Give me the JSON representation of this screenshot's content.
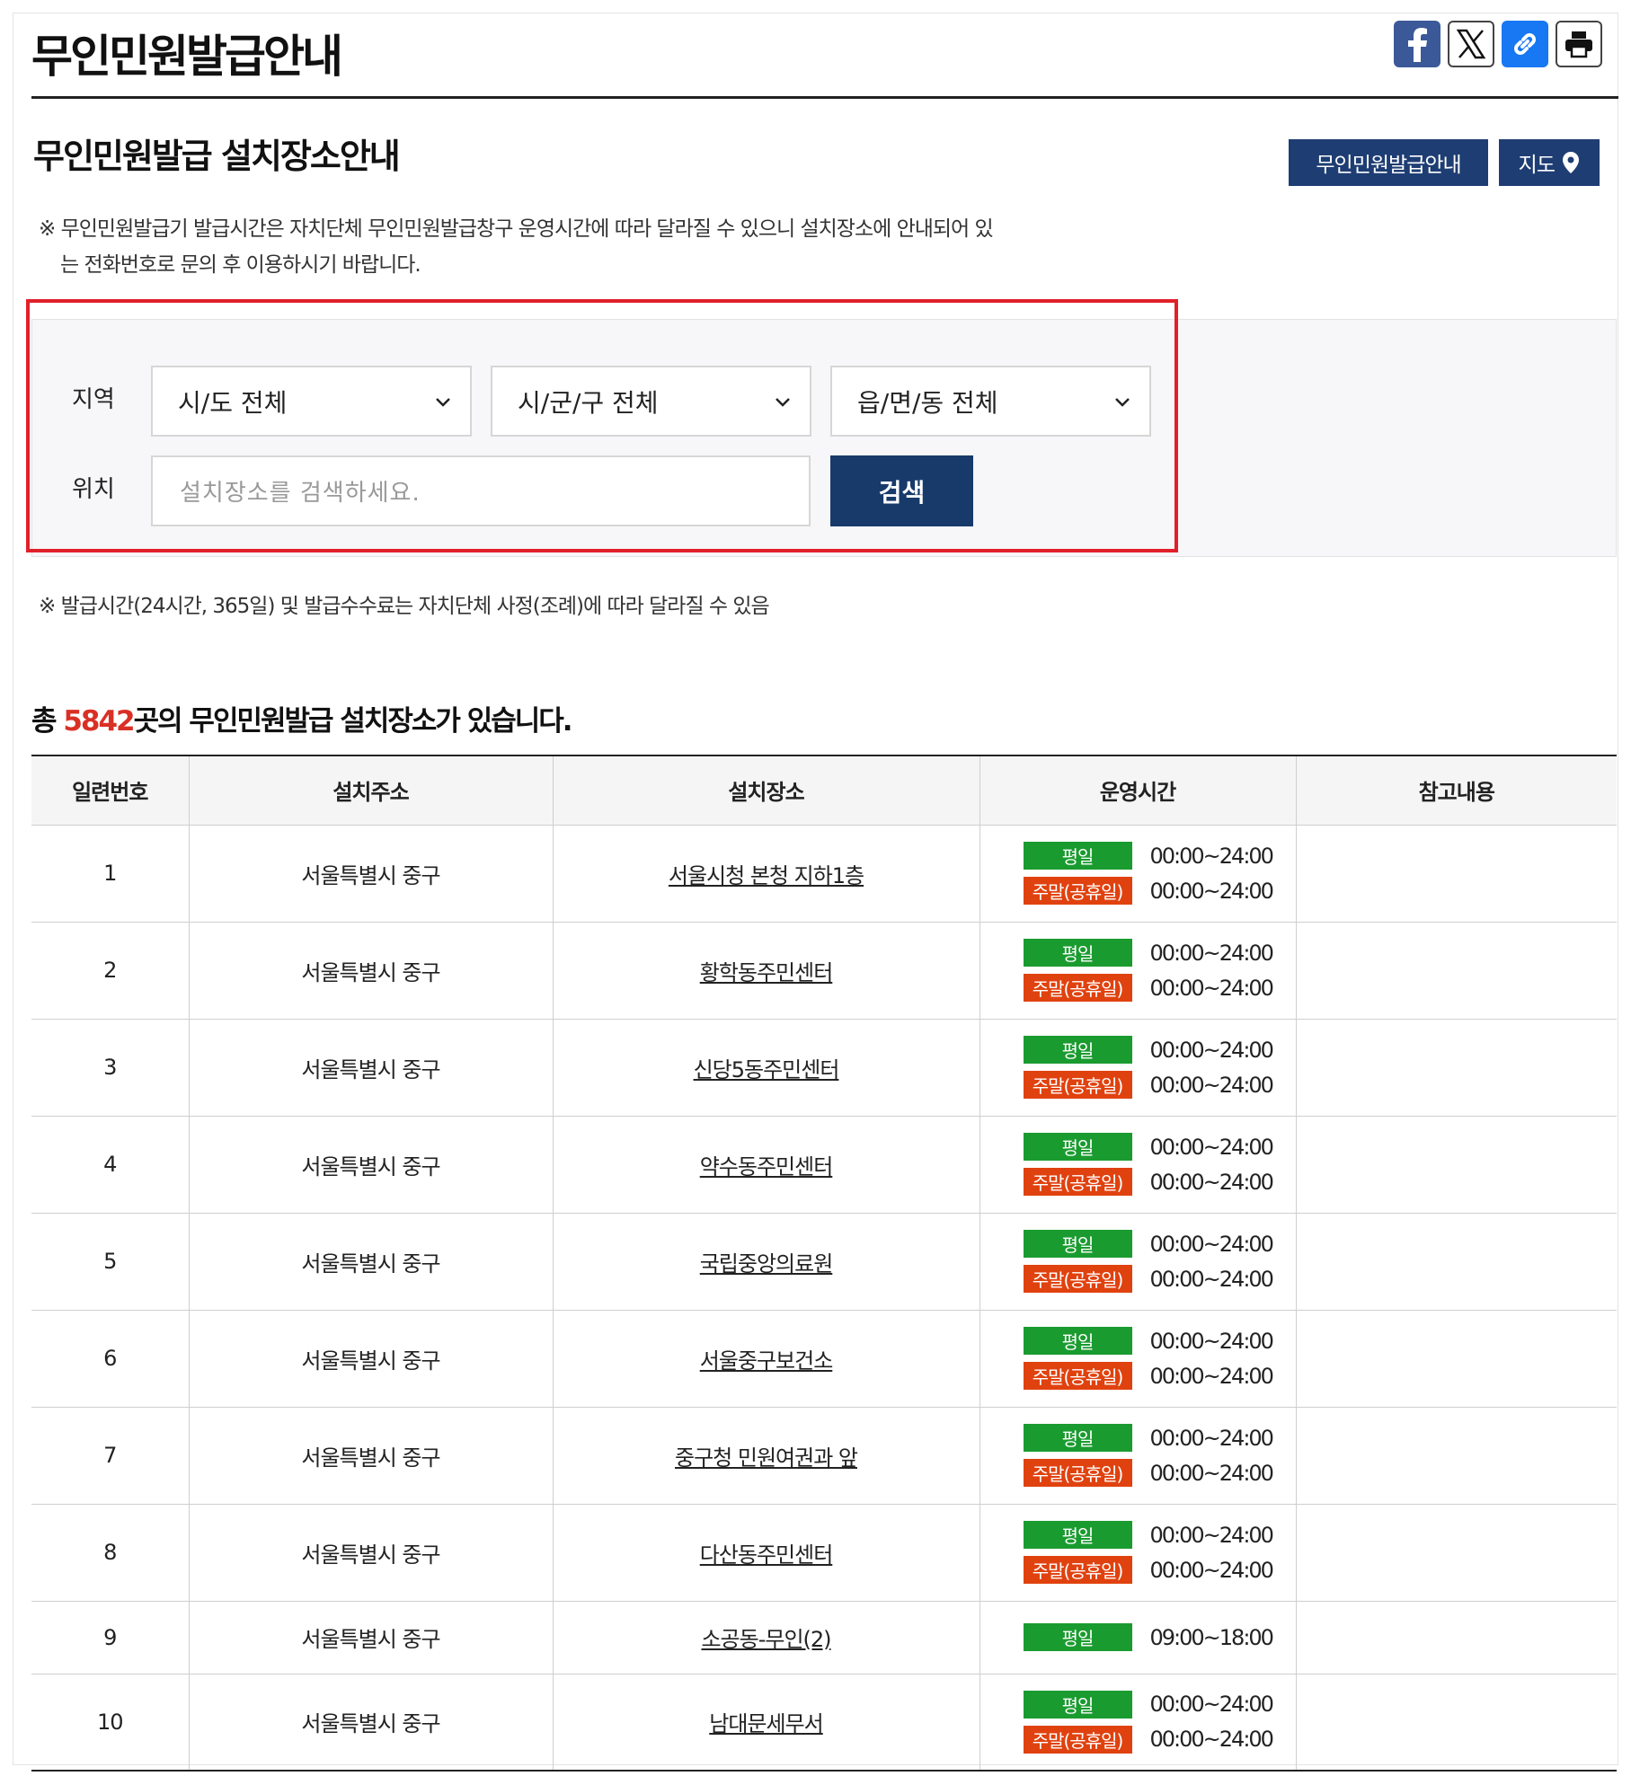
{
  "header": {
    "title": "무인민원발급안내",
    "share": [
      {
        "name": "facebook-icon"
      },
      {
        "name": "x-icon"
      },
      {
        "name": "link-icon"
      },
      {
        "name": "print-icon"
      }
    ]
  },
  "section": {
    "title": "무인민원발급 설치장소안내",
    "guide_button": "무인민원발급안내",
    "map_button": "지도",
    "notice_line1": "※ 무인민원발급기 발급시간은 자치단체 무인민원발급창구 운영시간에 따라 달라질 수 있으니 설치장소에 안내되어 있",
    "notice_line2": "는 전화번호로 문의 후 이용하시기 바랍니다."
  },
  "search": {
    "region_label": "지역",
    "location_label": "위치",
    "sido": "시/도 전체",
    "sigungu": "시/군/구 전체",
    "dong": "읍/면/동 전체",
    "placeholder": "설치장소를 검색하세요.",
    "button": "검색"
  },
  "notice2": "※ 발급시간(24시간, 365일) 및 발급수수료는 자치단체 사정(조례)에 따라 달라질 수 있음",
  "total": {
    "prefix": "총 ",
    "count": "5842",
    "suffix": "곳의 무인민원발급 설치장소가 있습니다."
  },
  "table": {
    "headers": [
      "일련번호",
      "설치주소",
      "설치장소",
      "운영시간",
      "참고내용"
    ],
    "weekday_label": "평일",
    "weekend_label": "주말(공휴일)",
    "rows": [
      {
        "no": "1",
        "address": "서울특별시 중구",
        "place": "서울시청 본청 지하1층",
        "weekday": "00:00~24:00",
        "weekend": "00:00~24:00",
        "note": ""
      },
      {
        "no": "2",
        "address": "서울특별시 중구",
        "place": "황학동주민센터",
        "weekday": "00:00~24:00",
        "weekend": "00:00~24:00",
        "note": ""
      },
      {
        "no": "3",
        "address": "서울특별시 중구",
        "place": "신당5동주민센터",
        "weekday": "00:00~24:00",
        "weekend": "00:00~24:00",
        "note": ""
      },
      {
        "no": "4",
        "address": "서울특별시 중구",
        "place": "약수동주민센터",
        "weekday": "00:00~24:00",
        "weekend": "00:00~24:00",
        "note": ""
      },
      {
        "no": "5",
        "address": "서울특별시 중구",
        "place": "국립중앙의료원",
        "weekday": "00:00~24:00",
        "weekend": "00:00~24:00",
        "note": ""
      },
      {
        "no": "6",
        "address": "서울특별시 중구",
        "place": "서울중구보건소",
        "weekday": "00:00~24:00",
        "weekend": "00:00~24:00",
        "note": ""
      },
      {
        "no": "7",
        "address": "서울특별시 중구",
        "place": "중구청 민원여권과 앞",
        "weekday": "00:00~24:00",
        "weekend": "00:00~24:00",
        "note": ""
      },
      {
        "no": "8",
        "address": "서울특별시 중구",
        "place": "다산동주민센터",
        "weekday": "00:00~24:00",
        "weekend": "00:00~24:00",
        "note": ""
      },
      {
        "no": "9",
        "address": "서울특별시 중구",
        "place": "소공동-무인(2)",
        "weekday": "09:00~18:00",
        "weekend": null,
        "note": ""
      },
      {
        "no": "10",
        "address": "서울특별시 중구",
        "place": "남대문세무서",
        "weekday": "00:00~24:00",
        "weekend": "00:00~24:00",
        "note": ""
      }
    ]
  },
  "colors": {
    "navy": "#1e3d73",
    "weekday_badge": "#1a9b2f",
    "weekend_badge": "#e0420f",
    "count_red": "#d93025",
    "highlight": "#e0202a"
  }
}
